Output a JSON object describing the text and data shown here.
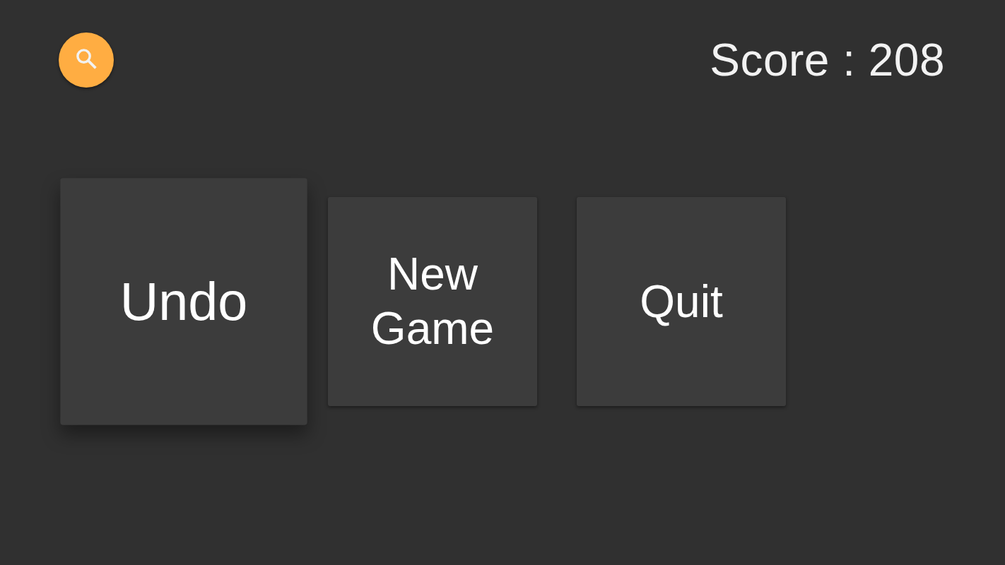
{
  "score": {
    "label": "Score : 208"
  },
  "buttons": [
    {
      "label": "Undo",
      "selected": true
    },
    {
      "label": "New Game",
      "selected": false
    },
    {
      "label": "Quit",
      "selected": false
    }
  ]
}
